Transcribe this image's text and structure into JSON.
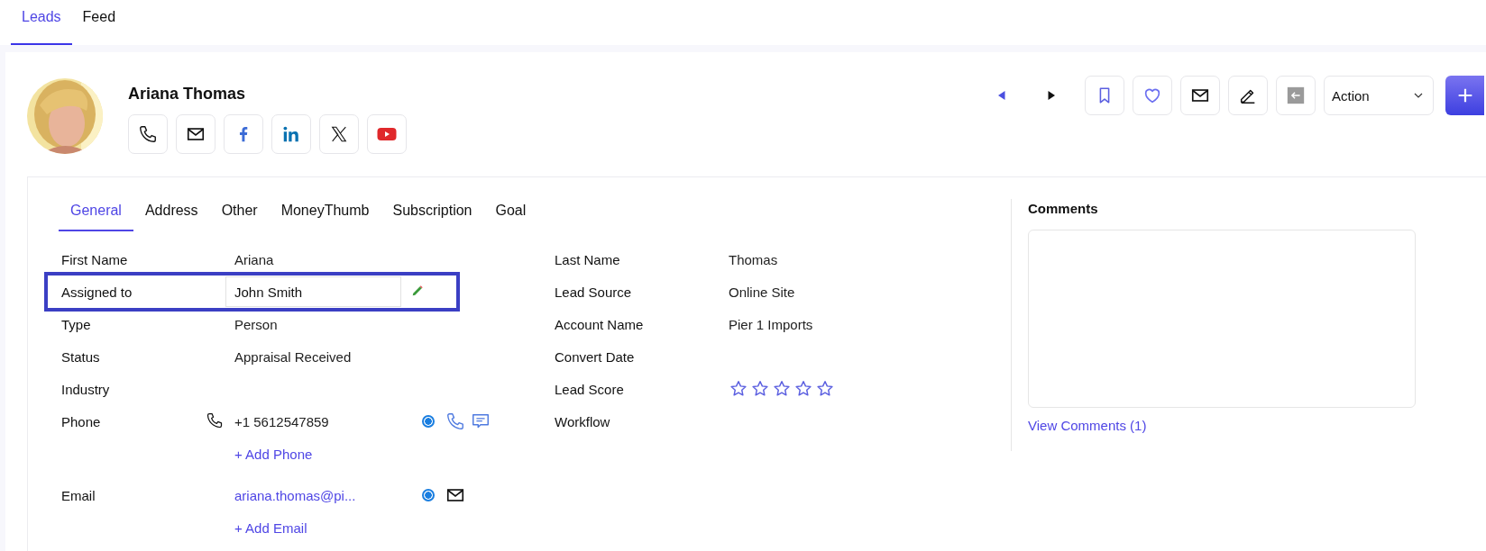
{
  "top_tabs": [
    {
      "label": "Leads",
      "selected": true
    },
    {
      "label": "Feed",
      "selected": false
    }
  ],
  "profile": {
    "name": "Ariana Thomas",
    "social": [
      {
        "kind": "phone"
      },
      {
        "kind": "email"
      },
      {
        "kind": "facebook"
      },
      {
        "kind": "linkedin"
      },
      {
        "kind": "x"
      },
      {
        "kind": "youtube"
      }
    ]
  },
  "toolbar": {
    "nav": [
      {
        "kind": "prev"
      },
      {
        "kind": "next"
      }
    ],
    "actions": [
      {
        "kind": "bookmark"
      },
      {
        "kind": "heart"
      },
      {
        "kind": "email"
      },
      {
        "kind": "edit"
      },
      {
        "kind": "back"
      }
    ],
    "action_select": {
      "value": "Action"
    }
  },
  "tabs": [
    {
      "label": "General",
      "selected": true
    },
    {
      "label": "Address",
      "selected": false
    },
    {
      "label": "Other",
      "selected": false
    },
    {
      "label": "MoneyThumb",
      "selected": false
    },
    {
      "label": "Subscription",
      "selected": false
    },
    {
      "label": "Goal",
      "selected": false
    }
  ],
  "left_fields": [
    {
      "kind": "text",
      "label": "First Name",
      "value": "Ariana"
    },
    {
      "kind": "input",
      "label": "Assigned to",
      "value": "John Smith",
      "editing": true
    },
    {
      "kind": "text",
      "label": "Type",
      "value": "Person"
    },
    {
      "kind": "text",
      "label": "Status",
      "value": "Appraisal Received"
    },
    {
      "kind": "text",
      "label": "Industry"
    },
    {
      "kind": "phone",
      "label": "Phone",
      "value": "+1 5612547859",
      "primary": true,
      "add_link": "+ Add Phone"
    },
    {
      "kind": "email",
      "label": "Email",
      "value": "ariana.thomas@pi...",
      "primary": true,
      "add_link": "+ Add Email"
    }
  ],
  "right_fields": [
    {
      "kind": "text",
      "label": "Last Name",
      "value": "Thomas"
    },
    {
      "kind": "text",
      "label": "Lead Source",
      "value": "Online Site"
    },
    {
      "kind": "text",
      "label": "Account Name",
      "value": "Pier 1 Imports"
    },
    {
      "kind": "text",
      "label": "Convert Date"
    },
    {
      "kind": "stars",
      "label": "Lead Score",
      "stars": 0
    },
    {
      "kind": "text",
      "label": "Workflow"
    }
  ],
  "comments": {
    "title": "Comments",
    "link": "View Comments (1)"
  }
}
